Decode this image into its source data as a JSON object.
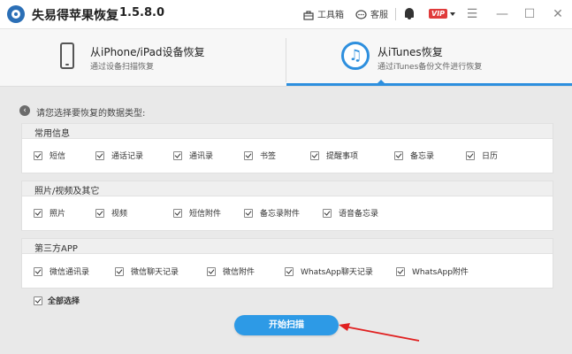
{
  "app": {
    "title": "失易得苹果恢复",
    "version": "1.5.8.0"
  },
  "toolbar": {
    "toolbox_label": "工具箱",
    "support_label": "客服",
    "vip_label": "VIP"
  },
  "modes": [
    {
      "title": "从iPhone/iPad设备恢复",
      "subtitle": "通过设备扫描恢复",
      "active": false
    },
    {
      "title": "从iTunes恢复",
      "subtitle": "通过iTunes备份文件进行恢复",
      "active": true
    }
  ],
  "instruction": "请您选择要恢复的数据类型:",
  "sections": [
    {
      "title": "常用信息",
      "items": [
        "短信",
        "通话记录",
        "通讯录",
        "书签",
        "提醒事项",
        "备忘录",
        "日历"
      ]
    },
    {
      "title": "照片/视频及其它",
      "items": [
        "照片",
        "视频",
        "短信附件",
        "备忘录附件",
        "语音备忘录"
      ]
    },
    {
      "title": "第三方APP",
      "items": [
        "微信通讯录",
        "微信聊天记录",
        "微信附件",
        "WhatsApp聊天记录",
        "WhatsApp附件"
      ]
    }
  ],
  "select_all_label": "全部选择",
  "scan_button_label": "开始扫描",
  "colors": {
    "accent": "#2d8fde",
    "button": "#2d9ae6",
    "arrow": "#e02020",
    "vip": "#e03b3b"
  }
}
